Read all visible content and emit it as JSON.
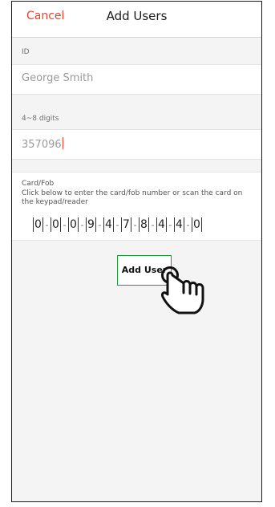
{
  "header": {
    "cancel_label": "Cancel",
    "title": "Add Users"
  },
  "id_field": {
    "label": "ID",
    "value": "George Smith"
  },
  "code_field": {
    "label": "4~8 digits",
    "value": "357096"
  },
  "card": {
    "title": "Card/Fob",
    "help_text": "Click below to enter the card/fob number or scan the card on the keypad/reader",
    "digits": [
      "0",
      "0",
      "0",
      "9",
      "4",
      "7",
      "8",
      "4",
      "4",
      "0"
    ],
    "separator": "-"
  },
  "add_button": {
    "label": "Add User"
  },
  "icons": {
    "pointer": "tap-hand-icon"
  },
  "colors": {
    "cancel": "#e8432e",
    "add_button_border": "#1f9a3c"
  }
}
